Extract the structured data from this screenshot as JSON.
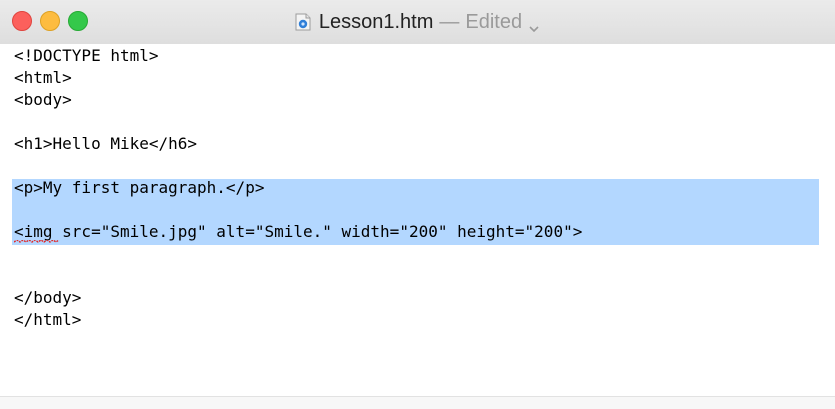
{
  "window": {
    "filename": "Lesson1.htm",
    "separator": "—",
    "status": "Edited",
    "icons": {
      "close": "close-traffic-light",
      "minimize": "minimize-traffic-light",
      "zoom": "zoom-traffic-light",
      "document": "htm-document-icon",
      "chevron": "chevron-down-icon"
    }
  },
  "editor": {
    "lines": [
      "<!DOCTYPE html>",
      "<html>",
      "<body>",
      "",
      "<h1>Hello Mike</h6>",
      "",
      "<p>My first paragraph.</p>",
      "",
      "<img src=\"Smile.jpg\" alt=\"Smile.\" width=\"200\" height=\"200\">",
      "",
      "",
      "</body>",
      "</html>"
    ],
    "selection_color": "#b3d7ff",
    "spellcheck_color": "#e0292a"
  }
}
